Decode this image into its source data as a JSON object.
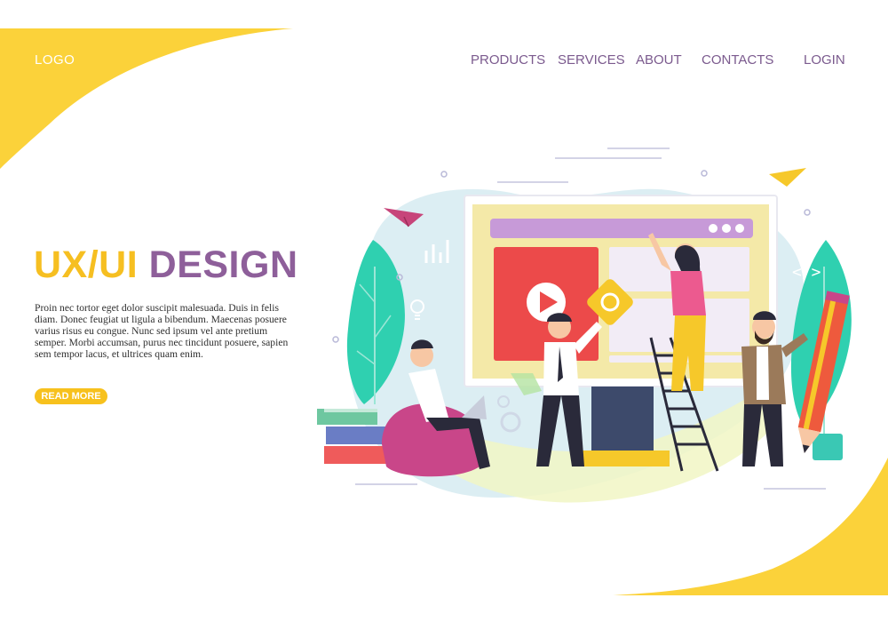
{
  "header": {
    "logo": "LOGO",
    "nav": {
      "products": "PRODUCTS",
      "services": "SERVICES",
      "about": "ABOUT",
      "contacts": "CONTACTS",
      "login": "LOGIN"
    }
  },
  "hero": {
    "title_part1": "UX/UI",
    "title_part2": "DESIGN",
    "body": "Proin nec tortor eget dolor suscipit malesuada. Duis in felis diam. Donec feugiat ut ligula a bibendum. Maecenas posuere varius risus eu congue. Nunc sed ipsum vel ante pretium semper. Morbi accumsan, purus nec tincidunt posuere, sapien sem tempor lacus, et ultrices quam enim.",
    "read_more": "READ MORE"
  },
  "colors": {
    "yellow": "#f6bf21",
    "purple": "#8e5f9a",
    "nav_text": "#7b5a8e",
    "button": "#f7c11d"
  }
}
